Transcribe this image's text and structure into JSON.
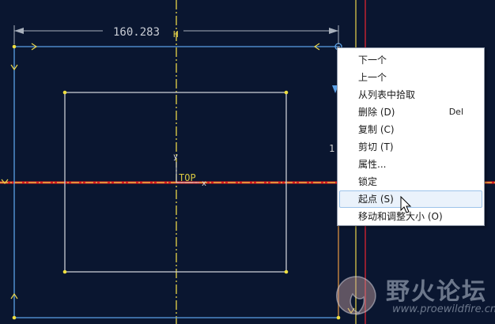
{
  "sketch": {
    "dimension_value": "160.283",
    "view_label": "TOP",
    "axis_x_label": "x",
    "axis_y_label": "y",
    "partial_dimension_text": "1",
    "colors": {
      "background": "#0a1630",
      "geometry": "#c8ccd4",
      "dimension": "#a8b0bc",
      "centerline": "#e8d44a",
      "rectangle_outer": "#5aa0e6",
      "highlight_red": "#e02020",
      "vertex": "#f0e040"
    }
  },
  "context_menu": {
    "items": [
      {
        "label": "下一个",
        "shortcut": ""
      },
      {
        "label": "上一个",
        "shortcut": ""
      },
      {
        "label": "从列表中拾取",
        "shortcut": ""
      },
      {
        "label": "删除 (D)",
        "shortcut": "Del"
      },
      {
        "label": "复制 (C)",
        "shortcut": ""
      },
      {
        "label": "剪切 (T)",
        "shortcut": ""
      },
      {
        "label": "属性...",
        "shortcut": ""
      },
      {
        "label": "锁定",
        "shortcut": ""
      },
      {
        "label": "起点 (S)",
        "shortcut": ""
      },
      {
        "label": "移动和调整大小 (O)",
        "shortcut": ""
      }
    ],
    "highlighted_item": "起点 (S)"
  },
  "watermark": {
    "title": "野火论坛",
    "url": "www.proewildfire.cn"
  }
}
